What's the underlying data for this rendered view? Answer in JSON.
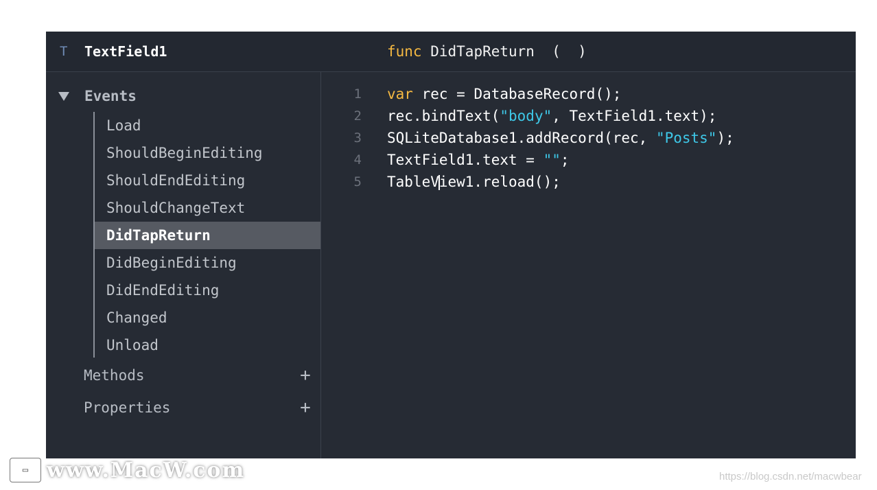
{
  "header": {
    "type_icon": "T",
    "object_name": "TextField1",
    "func_keyword": "func",
    "func_name": "DidTapReturn",
    "func_parens": "(  )"
  },
  "sidebar": {
    "events_label": "Events",
    "events": [
      "Load",
      "ShouldBeginEditing",
      "ShouldEndEditing",
      "ShouldChangeText",
      "DidTapReturn",
      "DidBeginEditing",
      "DidEndEditing",
      "Changed",
      "Unload"
    ],
    "selected_event": "DidTapReturn",
    "methods_label": "Methods",
    "properties_label": "Properties",
    "add_symbol": "+"
  },
  "code": {
    "lines": [
      {
        "n": "1",
        "tokens": [
          {
            "t": "var",
            "k": "kw"
          },
          {
            "t": " rec = DatabaseRecord();",
            "k": ""
          }
        ]
      },
      {
        "n": "2",
        "tokens": [
          {
            "t": "rec.bindText(",
            "k": ""
          },
          {
            "t": "\"body\"",
            "k": "str"
          },
          {
            "t": ", TextField1.text);",
            "k": ""
          }
        ]
      },
      {
        "n": "3",
        "tokens": [
          {
            "t": "SQLiteDatabase1.addRecord(rec, ",
            "k": ""
          },
          {
            "t": "\"Posts\"",
            "k": "str"
          },
          {
            "t": ");",
            "k": ""
          }
        ]
      },
      {
        "n": "4",
        "tokens": [
          {
            "t": "TextField1.text = ",
            "k": ""
          },
          {
            "t": "\"\"",
            "k": "str"
          },
          {
            "t": ";",
            "k": ""
          }
        ]
      },
      {
        "n": "5",
        "tokens": [
          {
            "t": "TableV",
            "k": ""
          },
          {
            "t": "|",
            "k": "caret"
          },
          {
            "t": "iew1.reload();",
            "k": ""
          }
        ]
      }
    ]
  },
  "watermark": {
    "logo_icon": "mac-monitor-icon",
    "text": "www.MacW.com"
  },
  "credit": "https://blog.csdn.net/macwbear",
  "colors": {
    "background": "#262b34",
    "keyword": "#f5b942",
    "string": "#3ec8e8",
    "selection": "#565a62"
  }
}
